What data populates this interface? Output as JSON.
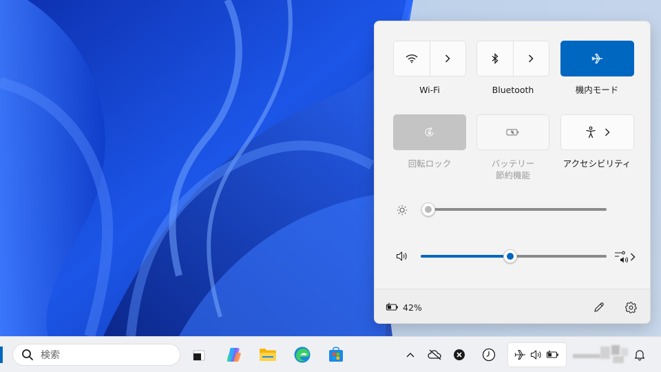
{
  "quick_settings": {
    "tiles": [
      {
        "label": "Wi-Fi",
        "icon": "wifi-icon",
        "state": "off",
        "has_chevron": true
      },
      {
        "label": "Bluetooth",
        "icon": "bluetooth-icon",
        "state": "off",
        "has_chevron": true
      },
      {
        "label": "機内モード",
        "icon": "airplane-icon",
        "state": "on",
        "has_chevron": false
      },
      {
        "label": "回転ロック",
        "icon": "rotation-lock-icon",
        "state": "disabled",
        "has_chevron": false
      },
      {
        "label_line1": "バッテリー",
        "label_line2": "節約機能",
        "icon": "battery-saver-icon",
        "state": "unavailable",
        "has_chevron": false
      },
      {
        "label": "アクセシビリティ",
        "icon": "accessibility-icon",
        "state": "off",
        "has_chevron": true
      }
    ],
    "brightness": {
      "icon": "brightness-icon",
      "value": 0
    },
    "volume": {
      "icon": "speaker-icon",
      "value": 0.48,
      "right_icon": "audio-output-icon"
    },
    "footer": {
      "battery_icon": "battery-charging-icon",
      "battery_text": "42%",
      "edit_icon": "pencil-icon",
      "settings_icon": "gear-icon"
    }
  },
  "taskbar": {
    "search_placeholder": "検索",
    "apps": [
      "task-view-icon",
      "copilot-icon",
      "file-explorer-icon",
      "edge-icon",
      "store-icon"
    ],
    "tray": [
      "chevron-up-icon",
      "onedrive-offline-icon",
      "close-circle-icon",
      "clock-app-icon",
      "airplane-icon",
      "speaker-icon",
      "battery-icon",
      "bell-icon"
    ]
  },
  "colors": {
    "accent": "#0067c0",
    "panel_bg": "#f3f3f3",
    "taskbar_bg": "#eef0f3",
    "wallpaper_blue": "#1a4bd6"
  }
}
